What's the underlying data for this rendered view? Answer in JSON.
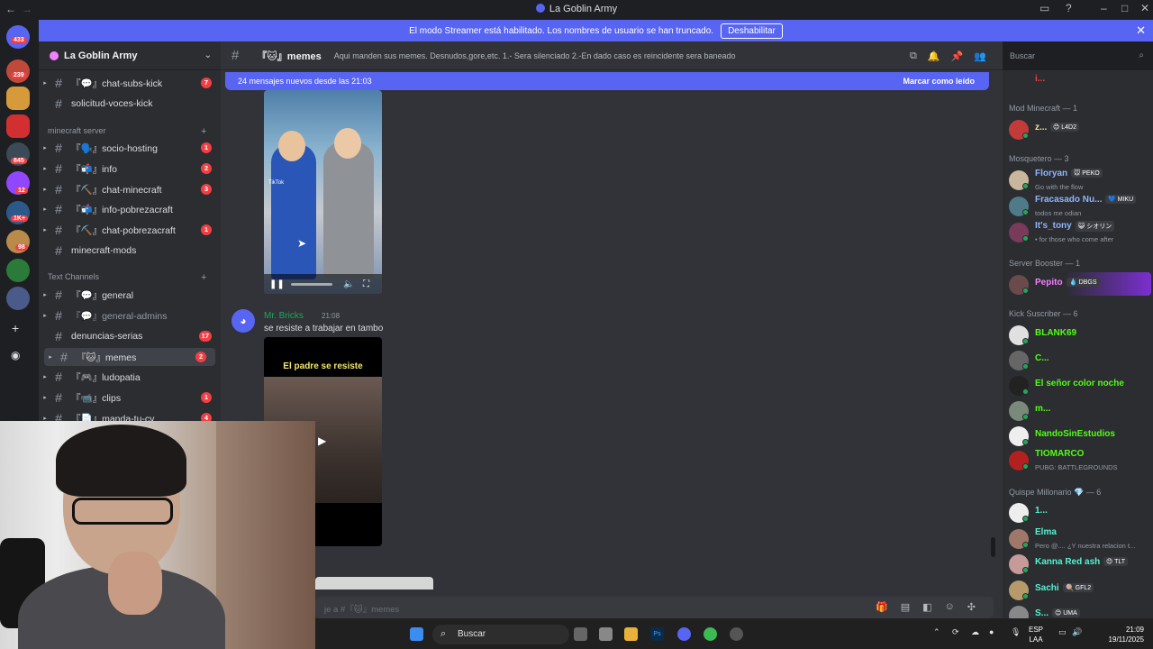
{
  "window": {
    "title": "La Goblin Army"
  },
  "banner": {
    "text": "El modo Streamer está habilitado. Los nombres de usuario se han truncado.",
    "button": "Deshabilitar"
  },
  "guilds": {
    "badges": [
      "433",
      "239",
      "845",
      "12",
      "1K+",
      "98"
    ]
  },
  "server": {
    "name": "La Goblin Army"
  },
  "channels": {
    "items": [
      {
        "name": "『💬』chat-subs-kick",
        "badge": "7"
      },
      {
        "name": "solicitud-voces-kick",
        "badge": ""
      },
      {
        "name": "『🗣️』socio-hosting",
        "badge": "1"
      },
      {
        "name": "『📬』info",
        "badge": "2"
      },
      {
        "name": "『⛏️』chat-minecraft",
        "badge": "3"
      },
      {
        "name": "『📬』info-pobrezacraft",
        "badge": ""
      },
      {
        "name": "『⛏️』chat-pobrezacraft",
        "badge": "1"
      },
      {
        "name": "minecraft-mods",
        "badge": ""
      },
      {
        "name": "『💬』general",
        "badge": ""
      },
      {
        "name": "『💬』general-admins",
        "badge": ""
      },
      {
        "name": "denuncias-serias",
        "badge": "17"
      },
      {
        "name": "『🐱』memes",
        "badge": "2"
      },
      {
        "name": "『🎮』ludopatia",
        "badge": ""
      },
      {
        "name": "『📹』clips",
        "badge": "1"
      },
      {
        "name": "『📄』manda-tu-cv",
        "badge": "4"
      }
    ],
    "categories": [
      "minecraft server",
      "Text Channels"
    ]
  },
  "header": {
    "channel": "『🐱』memes",
    "topic": "Aqui manden sus memes. Desnudos,gore,etc. 1.- Sera silenciado 2.-En dado caso es reincidente sera baneado",
    "search_placeholder": "Buscar"
  },
  "newbar": {
    "text": "24 mensajes nuevos desde las 21:03",
    "action": "Marcar como leído"
  },
  "messages": {
    "video1_watermark": "TikTok",
    "author": "Mr. Bricks",
    "time": "21:08",
    "text": "se resiste a trabajar en tambo",
    "video2_caption": "El padre se resiste"
  },
  "composer": {
    "placeholder": "je a #『🐱』memes"
  },
  "members": {
    "groups": [
      {
        "label": "Mod Minecraft — 1"
      },
      {
        "label": "Mosquetero — 3"
      },
      {
        "label": "Server Booster — 1"
      },
      {
        "label": "Kick Suscriber — 6"
      },
      {
        "label": "Quispe Millonario 💎 — 6"
      }
    ],
    "top_name": "i...",
    "rows": [
      {
        "name": "z...",
        "tag": "😊 L4D2",
        "sub": "",
        "color": "#f0e68c"
      },
      {
        "name": "Floryan",
        "tag": "🐭 PEKO",
        "sub": "Go with the flow",
        "color": "#8fb4ff"
      },
      {
        "name": "Fracasado Nu...",
        "tag": "💙 MIKU",
        "sub": "todos me odian",
        "color": "#8fb4ff"
      },
      {
        "name": "It's_tony",
        "tag": "😺 シオリン",
        "sub": "• for those who come after",
        "color": "#8fb4ff"
      },
      {
        "name": "Pepito",
        "tag": "💧 DBGS",
        "sub": "",
        "color": "#f47fff"
      },
      {
        "name": "BLANK69",
        "tag": "",
        "sub": "",
        "color": "#53fc18"
      },
      {
        "name": "C...",
        "tag": "",
        "sub": "",
        "color": "#53fc18"
      },
      {
        "name": "El señor color noche",
        "tag": "",
        "sub": "",
        "color": "#53fc18"
      },
      {
        "name": "m...",
        "tag": "",
        "sub": "",
        "color": "#53fc18"
      },
      {
        "name": "NandoSinEstudios",
        "tag": "",
        "sub": "",
        "color": "#53fc18"
      },
      {
        "name": "TIOMARCO",
        "tag": "",
        "sub": "PUBG: BATTLEGROUNDS",
        "color": "#53fc18"
      },
      {
        "name": "1...",
        "tag": "",
        "sub": "",
        "color": "#57f2d0"
      },
      {
        "name": "Elma",
        "tag": "",
        "sub": "Pero @.... ¿Y nuestra relacion t...",
        "color": "#57f2d0"
      },
      {
        "name": "Kanna Red ash",
        "tag": "😊 TLT",
        "sub": "",
        "color": "#57f2d0"
      },
      {
        "name": "Sachi",
        "tag": "🍭 GFL2",
        "sub": "",
        "color": "#57f2d0"
      },
      {
        "name": "S...",
        "tag": "😊 UMA",
        "sub": "",
        "color": "#57f2d0"
      }
    ]
  },
  "taskbar": {
    "search": "Buscar",
    "lang1": "ESP",
    "lang2": "LAA",
    "time": "21:09",
    "date": "19/11/2025"
  }
}
